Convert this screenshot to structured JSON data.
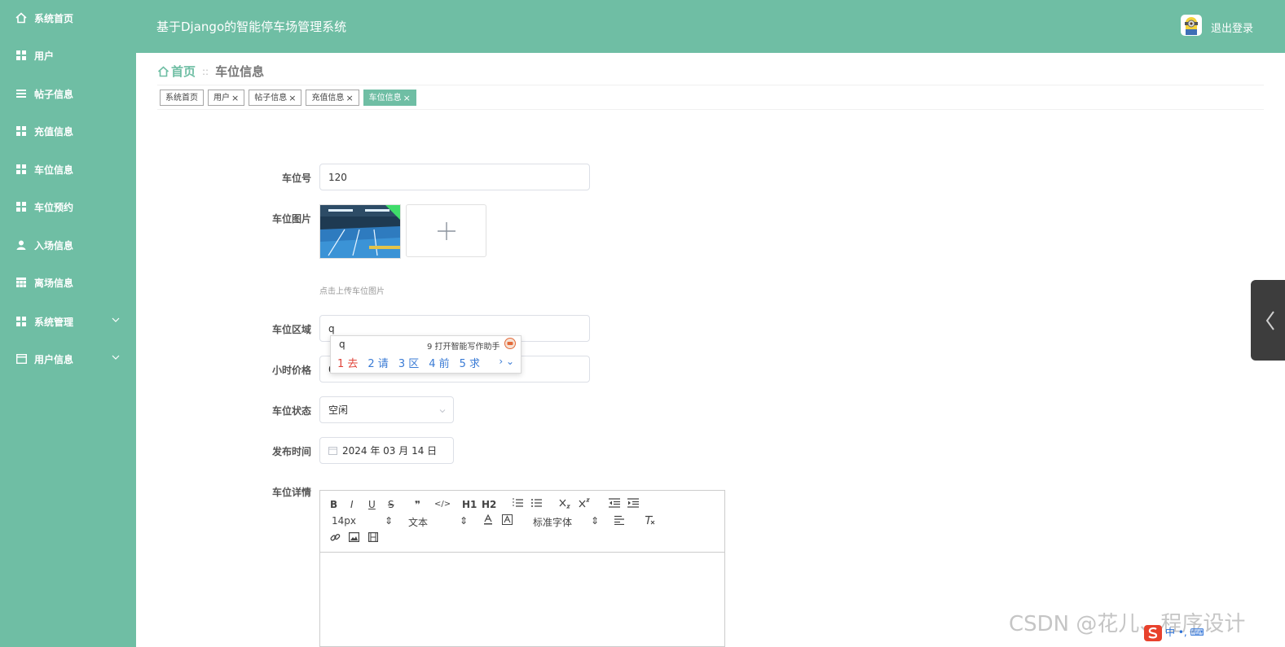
{
  "app": {
    "title": "基于Django的智能停车场管理系统",
    "logout_label": "退出登录",
    "colors": {
      "primary": "#6fbea4",
      "header_text": "#ffffff"
    }
  },
  "sidebar": {
    "items": [
      {
        "label": "系统首页",
        "icon": "home-icon"
      },
      {
        "label": "用户",
        "icon": "grid-icon"
      },
      {
        "label": "帖子信息",
        "icon": "list-icon"
      },
      {
        "label": "充值信息",
        "icon": "grid-icon"
      },
      {
        "label": "车位信息",
        "icon": "grid-icon"
      },
      {
        "label": "车位预约",
        "icon": "grid-icon"
      },
      {
        "label": "入场信息",
        "icon": "user-icon"
      },
      {
        "label": "离场信息",
        "icon": "table-icon"
      },
      {
        "label": "系统管理",
        "icon": "grid-icon",
        "expandable": true
      },
      {
        "label": "用户信息",
        "icon": "card-icon",
        "expandable": true
      }
    ]
  },
  "breadcrumb": {
    "home": "首页",
    "separator": "::",
    "current": "车位信息"
  },
  "tags": [
    {
      "label": "系统首页",
      "closable": false,
      "active": false
    },
    {
      "label": "用户",
      "closable": true,
      "active": false
    },
    {
      "label": "帖子信息",
      "closable": true,
      "active": false
    },
    {
      "label": "充值信息",
      "closable": true,
      "active": false
    },
    {
      "label": "车位信息",
      "closable": true,
      "active": true
    }
  ],
  "form": {
    "space_no": {
      "label": "车位号",
      "value": "120"
    },
    "image": {
      "label": "车位图片",
      "hint": "点击上传车位图片"
    },
    "area": {
      "label": "车位区域",
      "value": "q"
    },
    "price": {
      "label": "小时价格",
      "value": "0"
    },
    "status": {
      "label": "车位状态",
      "value": "空闲"
    },
    "publish_time": {
      "label": "发布时间",
      "value": "2024 年 03 月 14 日"
    },
    "details": {
      "label": "车位详情"
    }
  },
  "ime": {
    "typed": "q",
    "assistant": "9 打开智能写作助手",
    "candidates": [
      "1 去",
      "2 请",
      "3 区",
      "4 前",
      "5 求"
    ],
    "more": "› ⌄"
  },
  "editor": {
    "font_size": "14px",
    "heading": "文本",
    "font_family": "标准字体",
    "buttons": [
      "B",
      "I",
      "U",
      "S",
      "❞",
      "</>",
      "H1",
      "H2"
    ]
  },
  "watermark": "CSDN @花儿、程序设计",
  "taskbar": "中 •, ⌨"
}
